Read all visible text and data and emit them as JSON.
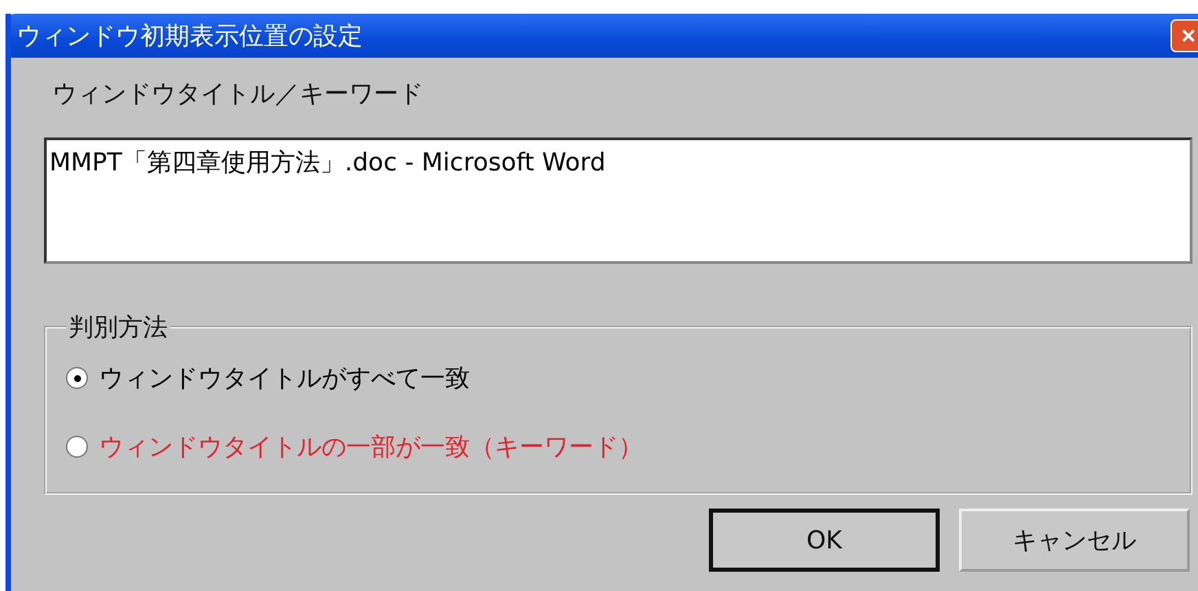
{
  "window": {
    "title": "ウィンドウ初期表示位置の設定",
    "close": "×"
  },
  "field": {
    "label": "ウィンドウタイトル／キーワード",
    "value": "MMPT「第四章使用方法」.doc - Microsoft Word"
  },
  "group": {
    "title": "判別方法",
    "options": [
      {
        "label": "ウィンドウタイトルがすべて一致",
        "selected": true,
        "color": "#000000"
      },
      {
        "label": "ウィンドウタイトルの一部が一致（キーワード）",
        "selected": false,
        "color": "#e8202a"
      }
    ]
  },
  "buttons": [
    {
      "label": "OK",
      "default": true
    },
    {
      "label": "キャンセル",
      "default": false
    }
  ]
}
